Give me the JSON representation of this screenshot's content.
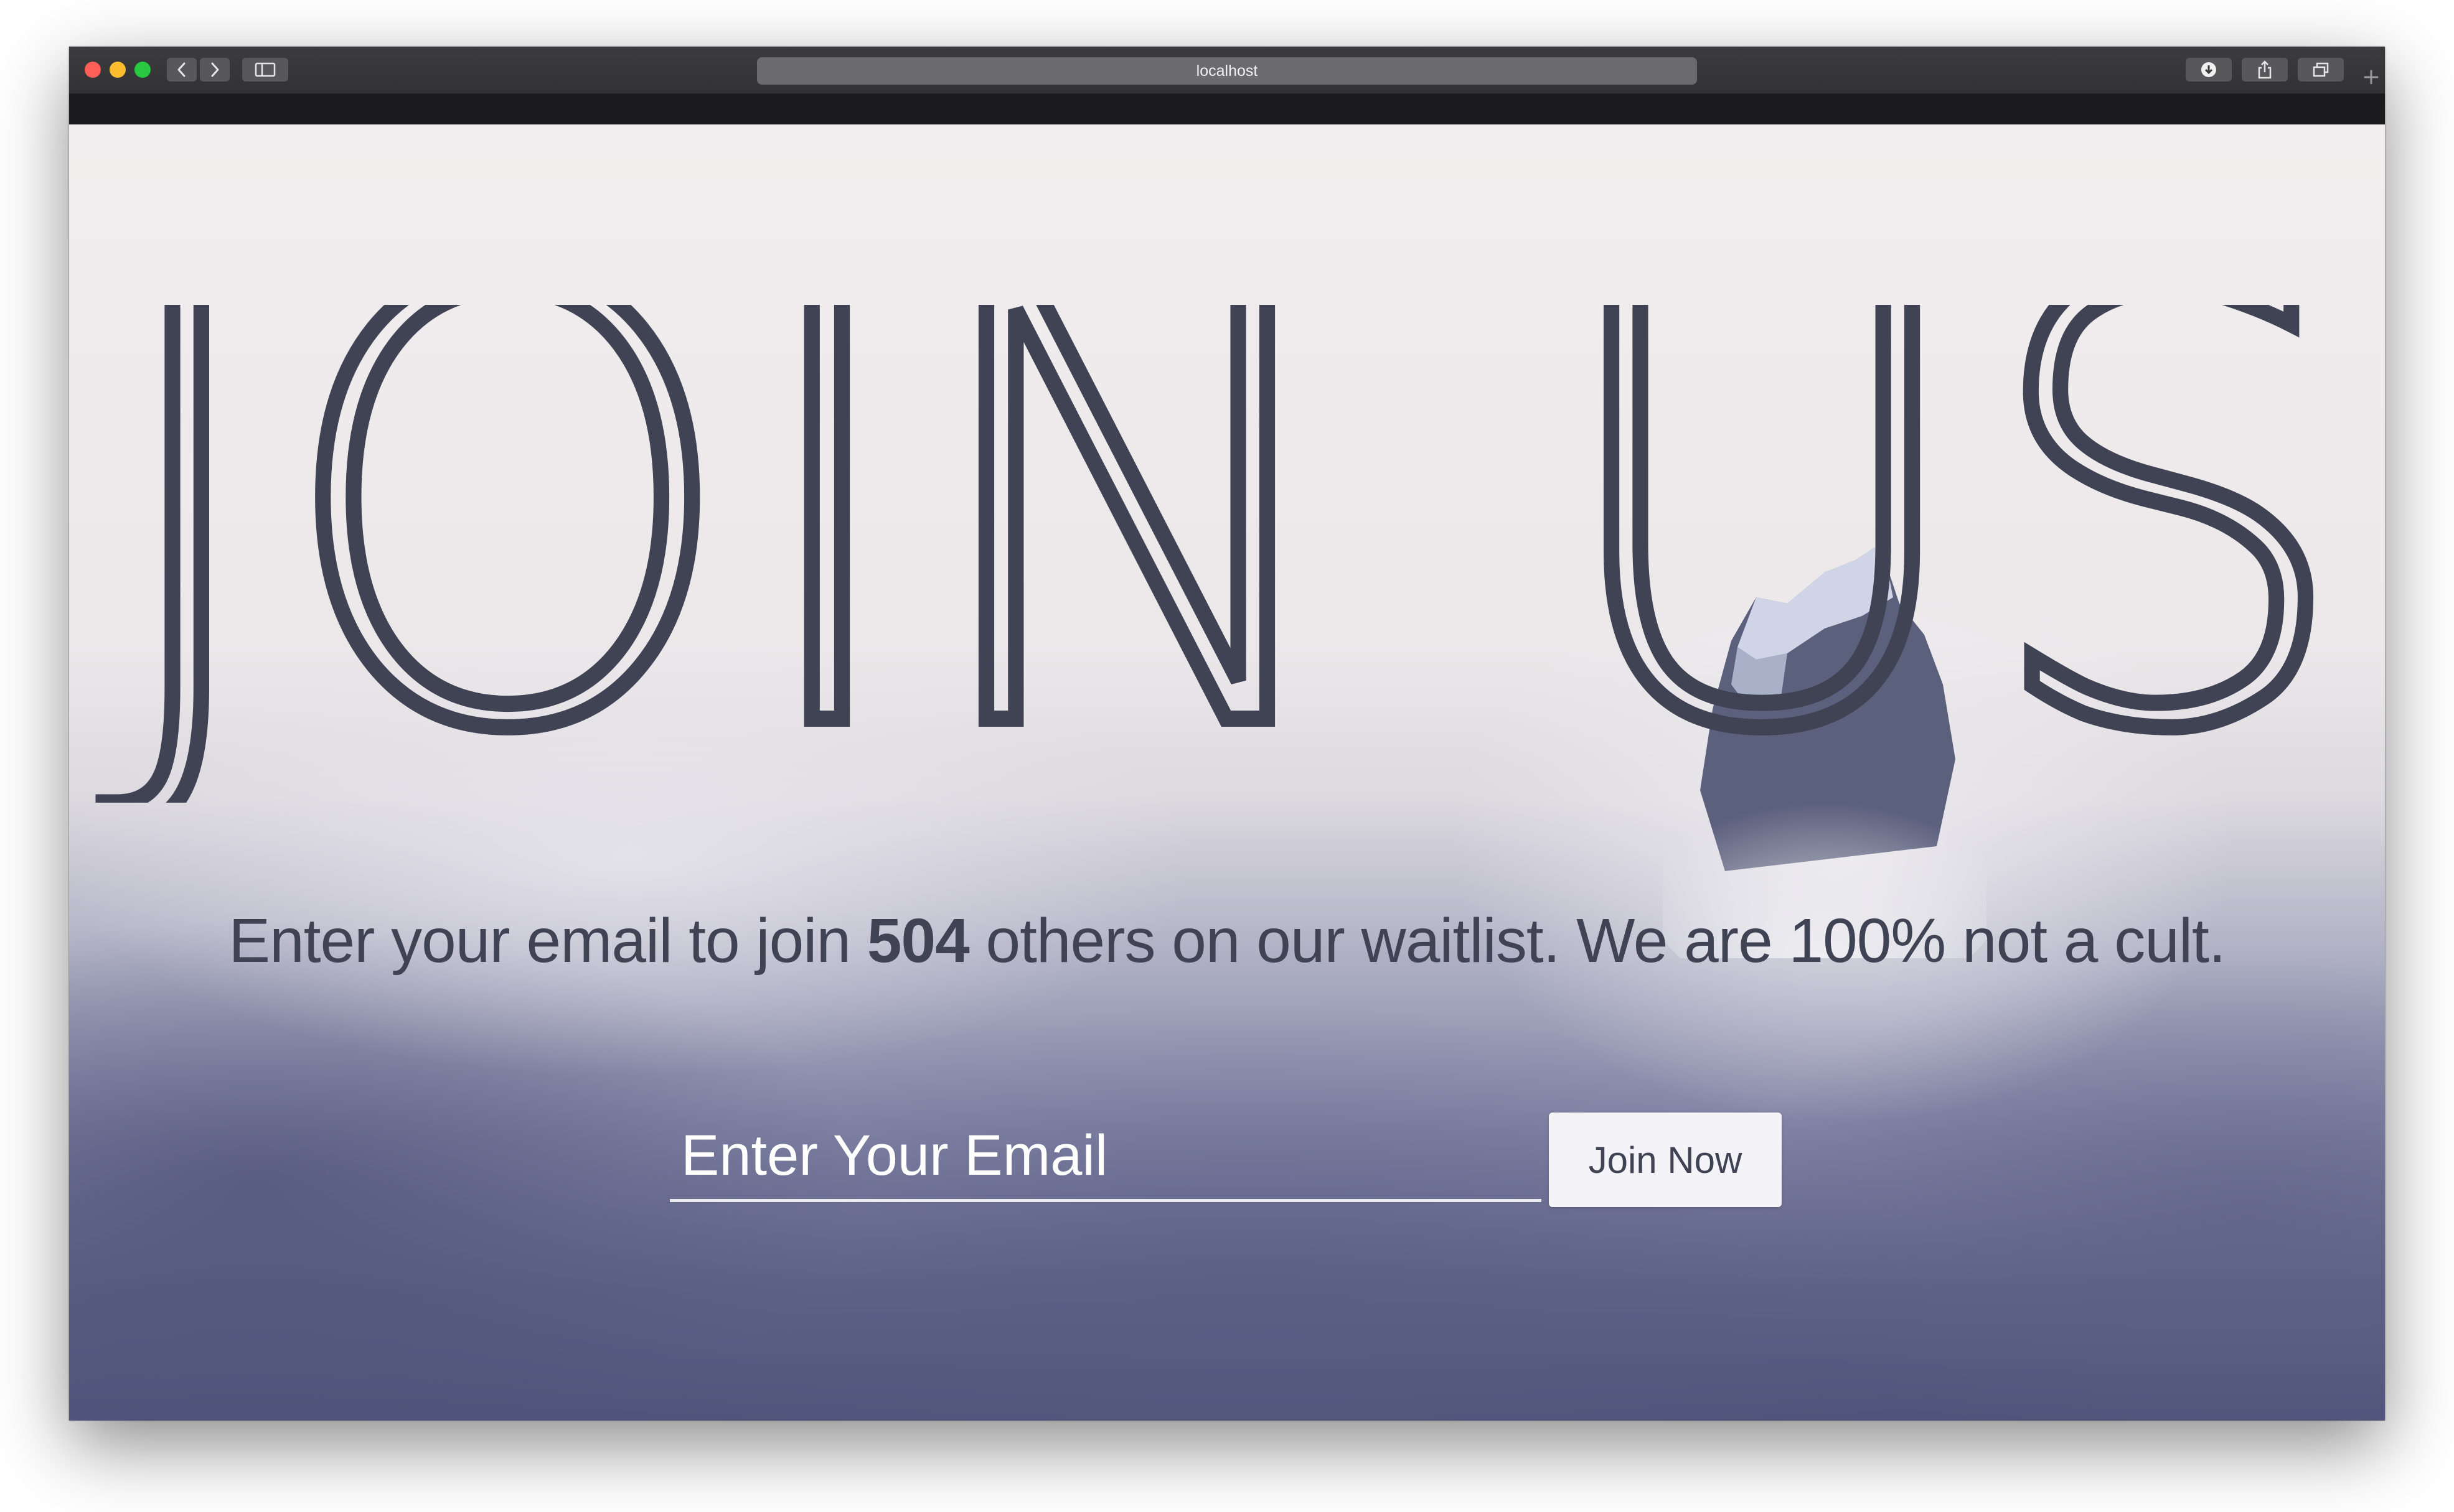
{
  "browser": {
    "url": "localhost",
    "new_tab_label": "+",
    "icons": {
      "back": "chevron-left-icon",
      "forward": "chevron-right-icon",
      "sidebar": "sidebar-icon",
      "download": "download-icon",
      "share": "share-icon",
      "tabs": "tabs-icon"
    }
  },
  "hero": {
    "title": "JOIN US",
    "subtitle_before": "Enter your email to join ",
    "subscriber_count": "504",
    "subtitle_after": " others on our waitlist. We are 100% not a cult.",
    "title_color": "#3f4354"
  },
  "signup": {
    "email_placeholder": "Enter Your Email",
    "email_value": "",
    "button_label": "Join Now"
  }
}
